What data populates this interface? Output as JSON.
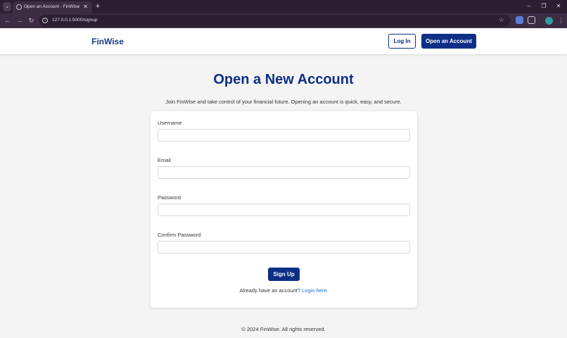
{
  "browser": {
    "tab_title": "Open an Account - FinWise",
    "url": "127.0.0.1:5000/signup"
  },
  "header": {
    "logo": "FinWise",
    "login_label": "Log In",
    "open_account_label": "Open an Account"
  },
  "main": {
    "title": "Open a New Account",
    "intro": "Join FinWise and take control of your financial future. Opening an account is quick, easy, and secure."
  },
  "form": {
    "username_label": "Username",
    "username_value": "",
    "email_label": "Email",
    "email_value": "",
    "password_label": "Password",
    "password_value": "",
    "confirm_label": "Confirm Password",
    "confirm_value": "",
    "submit_label": "Sign Up",
    "login_prompt": "Already have an account?",
    "login_link": "Login here."
  },
  "footer": {
    "text": "© 2024 FinWise. All rights reserved."
  },
  "colors": {
    "brand": "#0d2f86",
    "link": "#1a6fd0",
    "background": "#f4f4f4"
  },
  "icons": [
    "tab-menu-icon",
    "favicon-icon",
    "close-icon",
    "plus-icon",
    "minimize-icon",
    "restore-icon",
    "back-icon",
    "forward-icon",
    "reload-icon",
    "site-info-icon",
    "star-icon",
    "extension-icon",
    "puzzle-icon",
    "profile-icon",
    "more-icon"
  ]
}
